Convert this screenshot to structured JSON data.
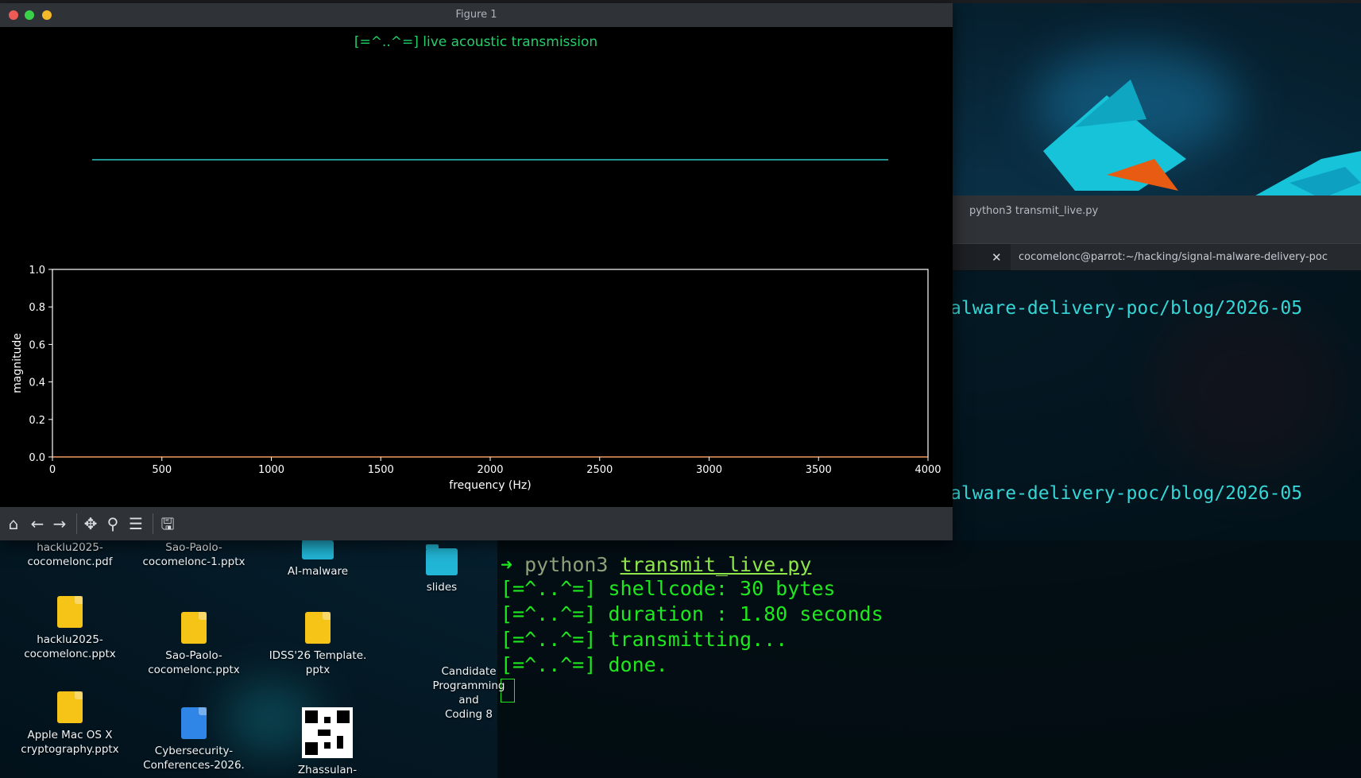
{
  "figure": {
    "window_title": "Figure 1",
    "plot_title": "[=^..^=] live acoustic transmission",
    "spectrum": {
      "ylabel": "magnitude",
      "xlabel": "frequency (Hz)",
      "xticks": [
        "0",
        "500",
        "1000",
        "1500",
        "2000",
        "2500",
        "3000",
        "3500",
        "4000"
      ],
      "yticks": [
        "0.0",
        "0.2",
        "0.4",
        "0.6",
        "0.8",
        "1.0"
      ]
    },
    "toolbar": [
      "home-icon",
      "back-icon",
      "forward-icon",
      "pan-icon",
      "zoom-icon",
      "configure-icon",
      "save-icon"
    ]
  },
  "chart_data": [
    {
      "type": "line",
      "title": "[=^..^=] live acoustic transmission",
      "series": [
        {
          "values": [
            0,
            0
          ]
        }
      ],
      "color": "#2fc6c6"
    },
    {
      "type": "line",
      "xlabel": "frequency (Hz)",
      "ylabel": "magnitude",
      "xlim": [
        0,
        4000
      ],
      "ylim": [
        0.0,
        1.0
      ],
      "series": [
        {
          "x": [
            0,
            4000
          ],
          "values": [
            0,
            0
          ]
        }
      ]
    }
  ],
  "terminal": {
    "window_title": "python3 transmit_live.py",
    "tab_path": "cocomelonc@parrot:~/hacking/signal-malware-delivery-poc",
    "line1": "alware-delivery-poc/blog/2026-05",
    "line2": "alware-delivery-poc/blog/2026-05",
    "prompt_arrow": "➜",
    "cmd": "python3",
    "script": "transmit_live.py",
    "out1": "[=^..^=] shellcode: 30 bytes",
    "out2": "[=^..^=] duration : 1.80 seconds",
    "out3": "[=^..^=] transmitting...",
    "out4": "[=^..^=] done."
  },
  "desktop": {
    "icons": [
      {
        "label": "hacklu2025-\ncocomelonc.pdf"
      },
      {
        "label": "Sao-Paolo-\ncocomelonc-1.pptx"
      },
      {
        "label": "AI-malware"
      },
      {
        "label": "slides"
      },
      {
        "label": "hacklu2025-\ncocomelonc.pptx"
      },
      {
        "label": "Sao-Paolo-\ncocomelonc.pptx"
      },
      {
        "label": "IDSS'26 Template.\npptx"
      },
      {
        "label": "Candidate\nProgramming and\nCoding 8"
      },
      {
        "label": "Apple Mac OS X\ncryptography.pptx"
      },
      {
        "label": "Cybersecurity-\nConferences-2026."
      },
      {
        "label": "Zhassulan-"
      }
    ]
  }
}
